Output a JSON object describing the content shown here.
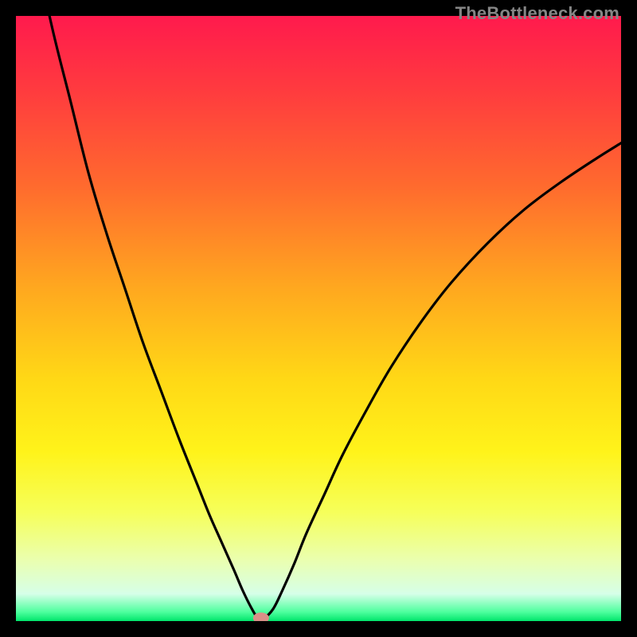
{
  "watermark": "TheBottleneck.com",
  "chart_data": {
    "type": "line",
    "title": "",
    "xlabel": "",
    "ylabel": "",
    "xlim": [
      0,
      100
    ],
    "ylim": [
      0,
      100
    ],
    "grid": false,
    "legend": false,
    "gradient_stops": [
      {
        "offset": 0.0,
        "color": "#ff1a4d"
      },
      {
        "offset": 0.12,
        "color": "#ff3a3f"
      },
      {
        "offset": 0.28,
        "color": "#ff6a2e"
      },
      {
        "offset": 0.45,
        "color": "#ffa81f"
      },
      {
        "offset": 0.6,
        "color": "#ffd816"
      },
      {
        "offset": 0.72,
        "color": "#fff31a"
      },
      {
        "offset": 0.82,
        "color": "#f6ff5a"
      },
      {
        "offset": 0.9,
        "color": "#eaffb0"
      },
      {
        "offset": 0.955,
        "color": "#d6ffe8"
      },
      {
        "offset": 0.985,
        "color": "#4dff9e"
      },
      {
        "offset": 1.0,
        "color": "#00e56b"
      }
    ],
    "marker": {
      "x": 40.5,
      "y": 0.5,
      "color": "#d99088"
    },
    "series": [
      {
        "name": "curve",
        "color": "#000000",
        "x": [
          0,
          3,
          6,
          9,
          12,
          15,
          18,
          21,
          24,
          27,
          30,
          32,
          34,
          36,
          37.5,
          39,
          40,
          41,
          42.5,
          44,
          46,
          48,
          51,
          54,
          58,
          62,
          67,
          72,
          78,
          84,
          90,
          96,
          100
        ],
        "y": [
          127,
          112,
          98,
          86,
          74,
          64,
          55,
          46,
          38,
          30,
          22.5,
          17.5,
          13,
          8.5,
          5,
          2,
          0.5,
          0.5,
          2,
          5,
          9.5,
          14.5,
          21,
          27.5,
          35,
          42,
          49.5,
          56,
          62.5,
          68,
          72.5,
          76.5,
          79
        ]
      }
    ]
  }
}
